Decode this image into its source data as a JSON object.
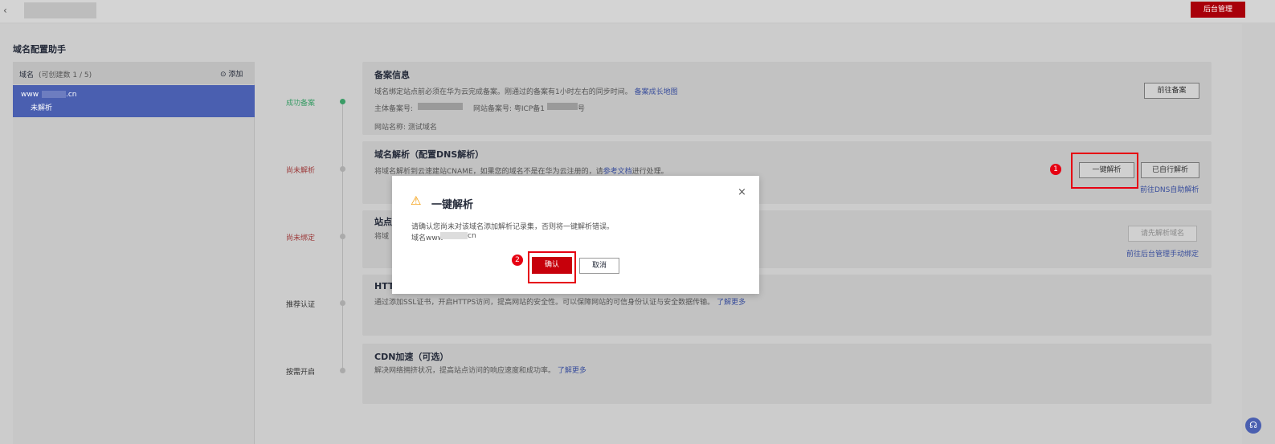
{
  "header": {
    "back_icon": "chevron-left-icon",
    "admin_button": "后台管理"
  },
  "page": {
    "title": "域名配置助手"
  },
  "sidebar": {
    "label": "域名",
    "count": "(可创建数 1 / 5)",
    "add": "添加",
    "item_name_prefix": "www",
    "item_name_suffix": ".cn",
    "item_status": "未解析"
  },
  "steps": [
    {
      "status": "成功备案",
      "color": "#3a9c66"
    },
    {
      "status": "尚未解析",
      "color": "#9c3a3a"
    },
    {
      "status": "尚未绑定",
      "color": "#9c3a3a"
    },
    {
      "status": "推荐认证",
      "color": "#333333"
    },
    {
      "status": "按需开启",
      "color": "#333333"
    }
  ],
  "record": {
    "title": "备案信息",
    "desc": "域名绑定站点前必须在华为云完成备案。刚通过的备案有1小时左右的同步时间。",
    "link": "备案成长地图",
    "subject_label": "主体备案号:",
    "website_label": "网站备案号: 粤ICP备1",
    "website_suffix": "号",
    "site_name_label": "网站名称:",
    "site_name": "测试域名",
    "button": "前往备案"
  },
  "dns": {
    "title": "域名解析（配置DNS解析）",
    "desc": "将域名解析到云速建站CNAME，如果您的域名不是在华为云注册的，请",
    "link": "参考文档",
    "desc_end": "进行处理。",
    "one_click": "一键解析",
    "self": "已自行解析",
    "auto_link": "前往DNS自助解析"
  },
  "bind": {
    "title": "站点",
    "desc": "将域",
    "button": "请先解析域名",
    "link": "前往后台管理手动绑定"
  },
  "https": {
    "title": "HTT",
    "desc": "通过添加SSL证书，开启HTTPS访问，提高网站的安全性。可以保障网站的可信身份认证与安全数据传输。",
    "link": "了解更多"
  },
  "cdn": {
    "title": "CDN加速（可选）",
    "desc": "解决网络拥挤状况，提高站点访问的响应速度和成功率。",
    "link": "了解更多"
  },
  "dialog": {
    "title": "一键解析",
    "line1": "请确认您尚未对该域名添加解析记录集，否则将一键解析错误。",
    "line2_prefix": "域名www",
    "line2_suffix": "cn",
    "confirm": "确认",
    "cancel": "取消"
  },
  "markers": {
    "one": "1",
    "two": "2"
  },
  "colors": {
    "accent": "#a8000a",
    "highlight": "#e60012",
    "selected": "#4a5fb0"
  }
}
